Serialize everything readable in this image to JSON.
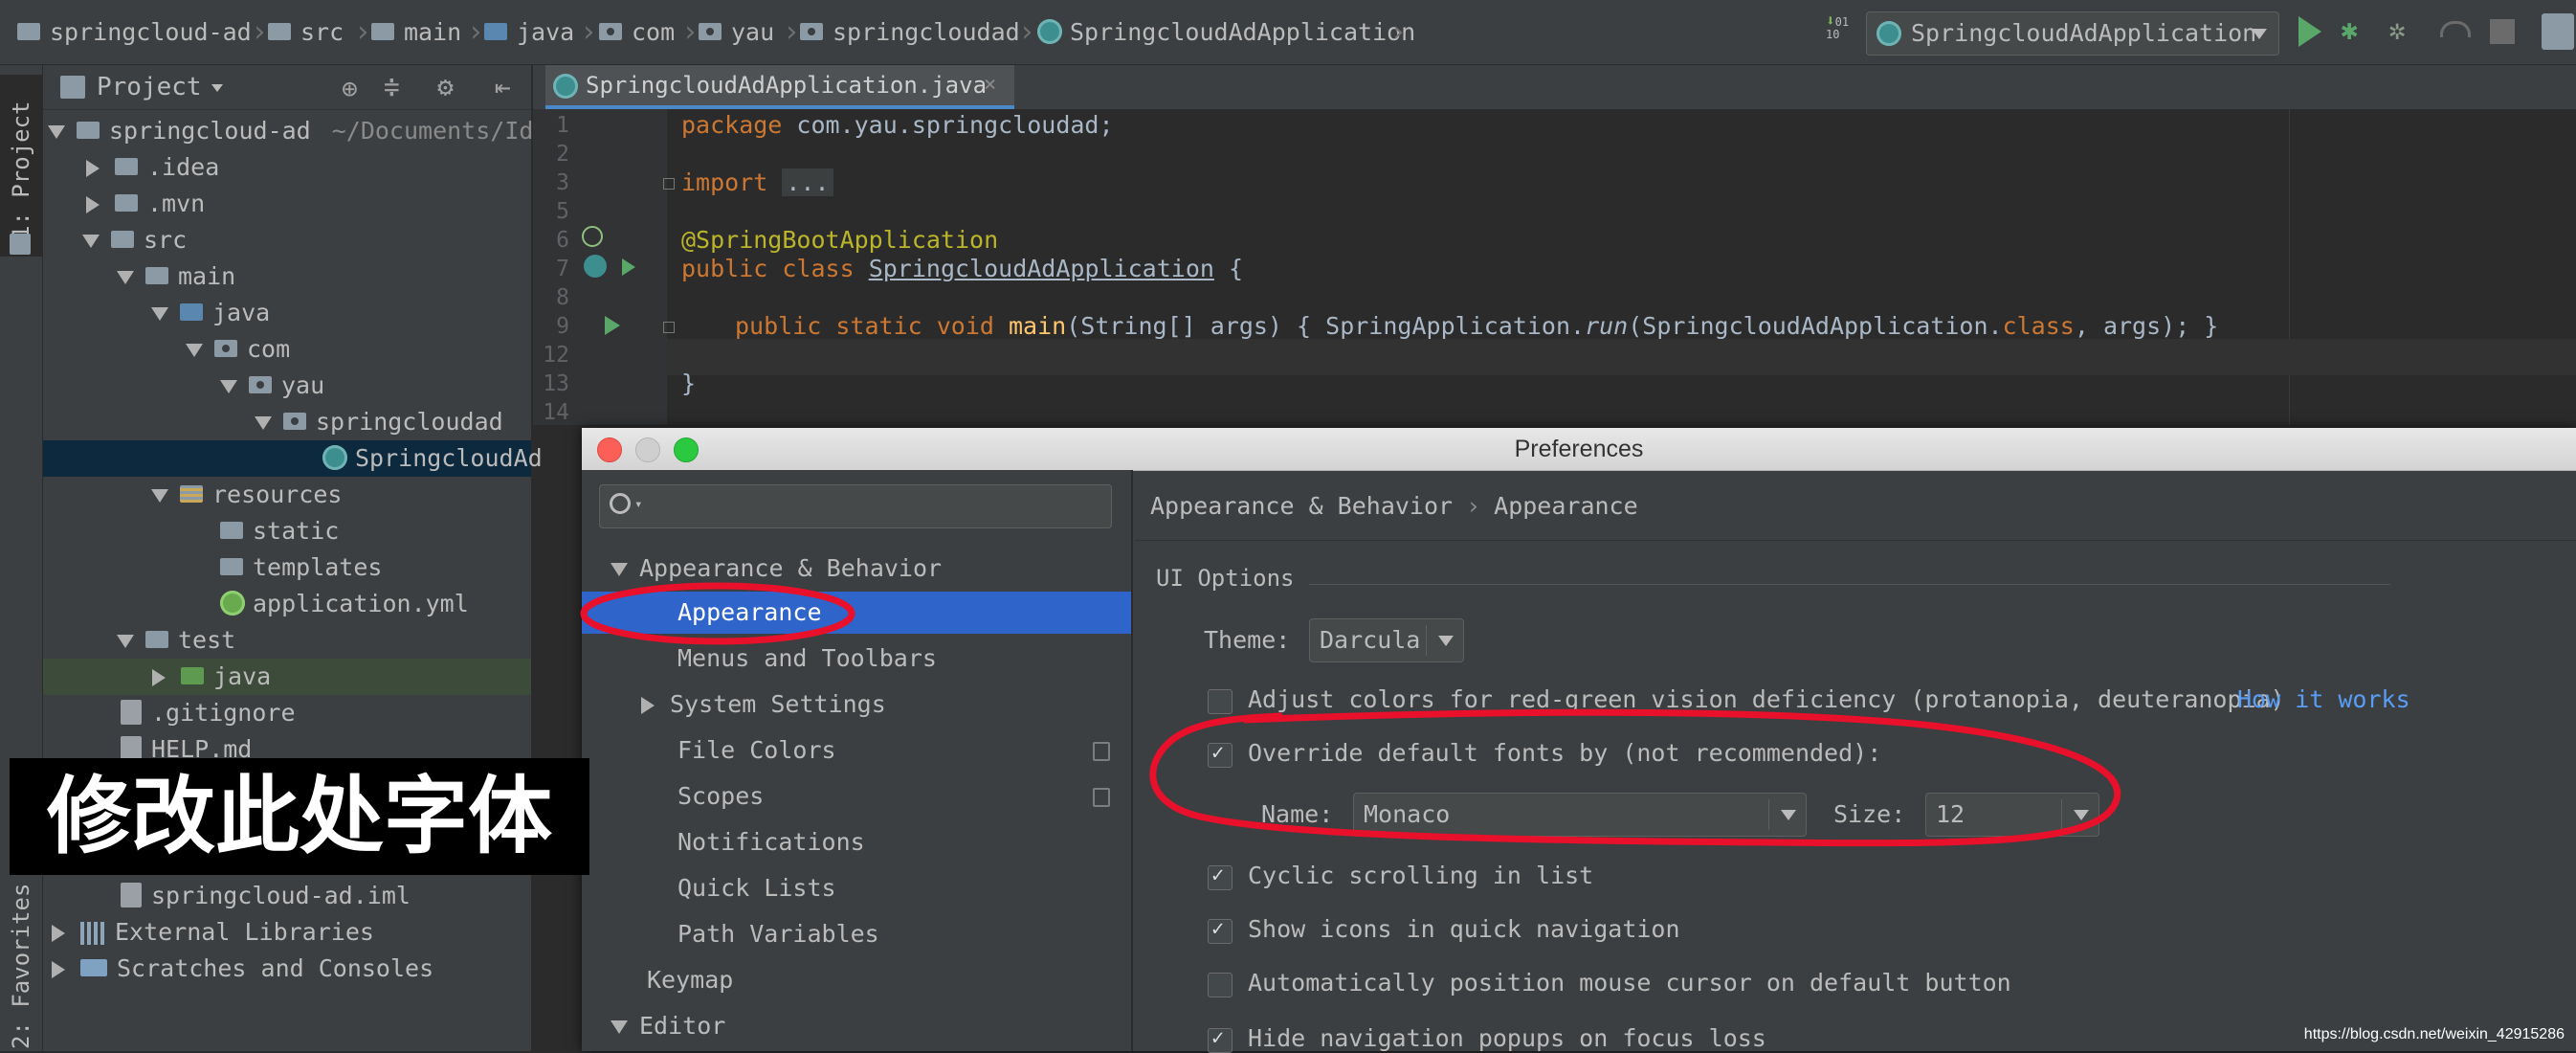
{
  "navbar": {
    "crumbs": [
      "springcloud-ad",
      "src",
      "main",
      "java",
      "com",
      "yau",
      "springcloudad",
      "SpringcloudAdApplication"
    ],
    "run_config": "SpringcloudAdApplication"
  },
  "left_strip": {
    "project_label": "1: Project",
    "favorites_label": "2: Favorites"
  },
  "project_panel": {
    "title": "Project",
    "tree": [
      {
        "label": "springcloud-ad",
        "extra": "~/Documents/Ide"
      },
      {
        "label": ".idea"
      },
      {
        "label": ".mvn"
      },
      {
        "label": "src"
      },
      {
        "label": "main"
      },
      {
        "label": "java"
      },
      {
        "label": "com"
      },
      {
        "label": "yau"
      },
      {
        "label": "springcloudad"
      },
      {
        "label": "SpringcloudAd"
      },
      {
        "label": "resources"
      },
      {
        "label": "static"
      },
      {
        "label": "templates"
      },
      {
        "label": "application.yml"
      },
      {
        "label": "test"
      },
      {
        "label": "java"
      },
      {
        "label": ".gitignore"
      },
      {
        "label": "HELP.md"
      },
      {
        "label": "springcloud-ad.iml"
      },
      {
        "label": "External Libraries"
      },
      {
        "label": "Scratches and Consoles"
      }
    ]
  },
  "editor": {
    "tab_label": "SpringcloudAdApplication.java",
    "line_numbers": [
      "1",
      "2",
      "3",
      "5",
      "6",
      "7",
      "8",
      "9",
      "12",
      "13",
      "14"
    ],
    "code": {
      "l1_kw": "package",
      "l1_rest": " com.yau.springcloudad;",
      "l3_kw": "import",
      "l3_fold": "...",
      "l6": "@SpringBootApplication",
      "l7_kw": "public class",
      "l7_name": "SpringcloudAdApplication",
      "l7_rest": " {",
      "l9_kw": "public static void",
      "l9_fn": "main",
      "l9_args": "(String[] args)",
      "l9_body": " { SpringApplication.",
      "l9_run": "run",
      "l9_call": "(SpringcloudAdApplication.",
      "l9_class": "class",
      "l9_end": ", args); }",
      "l13": "}"
    }
  },
  "preferences": {
    "title": "Preferences",
    "sidebar": [
      {
        "label": "Appearance & Behavior"
      },
      {
        "label": "Appearance"
      },
      {
        "label": "Menus and Toolbars"
      },
      {
        "label": "System Settings"
      },
      {
        "label": "File Colors"
      },
      {
        "label": "Scopes"
      },
      {
        "label": "Notifications"
      },
      {
        "label": "Quick Lists"
      },
      {
        "label": "Path Variables"
      },
      {
        "label": "Keymap"
      },
      {
        "label": "Editor"
      }
    ],
    "breadcrumb_section": "Appearance & Behavior",
    "breadcrumb_sep": "›",
    "breadcrumb_page": "Appearance",
    "ui_options_title": "UI Options",
    "theme_label": "Theme:",
    "theme_value": "Darcula",
    "adjust_colors_label": "Adjust colors for red-green vision deficiency (protanopia, deuteranopia)",
    "how_it_works": "How it works",
    "override_fonts_label": "Override default fonts by (not recommended):",
    "name_label": "Name:",
    "name_value": "Monaco",
    "size_label": "Size:",
    "size_value": "12",
    "cyclic_label": "Cyclic scrolling in list",
    "show_icons_label": "Show icons in quick navigation",
    "auto_mouse_label": "Automatically position mouse cursor on default button",
    "hide_nav_label": "Hide navigation popups on focus loss",
    "check_mark": "✓"
  },
  "overlay_text": "修改此处字体",
  "watermark": "https://blog.csdn.net/weixin_42915286",
  "colors": {
    "selection": "#2f65ca",
    "link": "#589df6",
    "annotation_red": "#e8102a",
    "keyword": "#cc7832"
  }
}
